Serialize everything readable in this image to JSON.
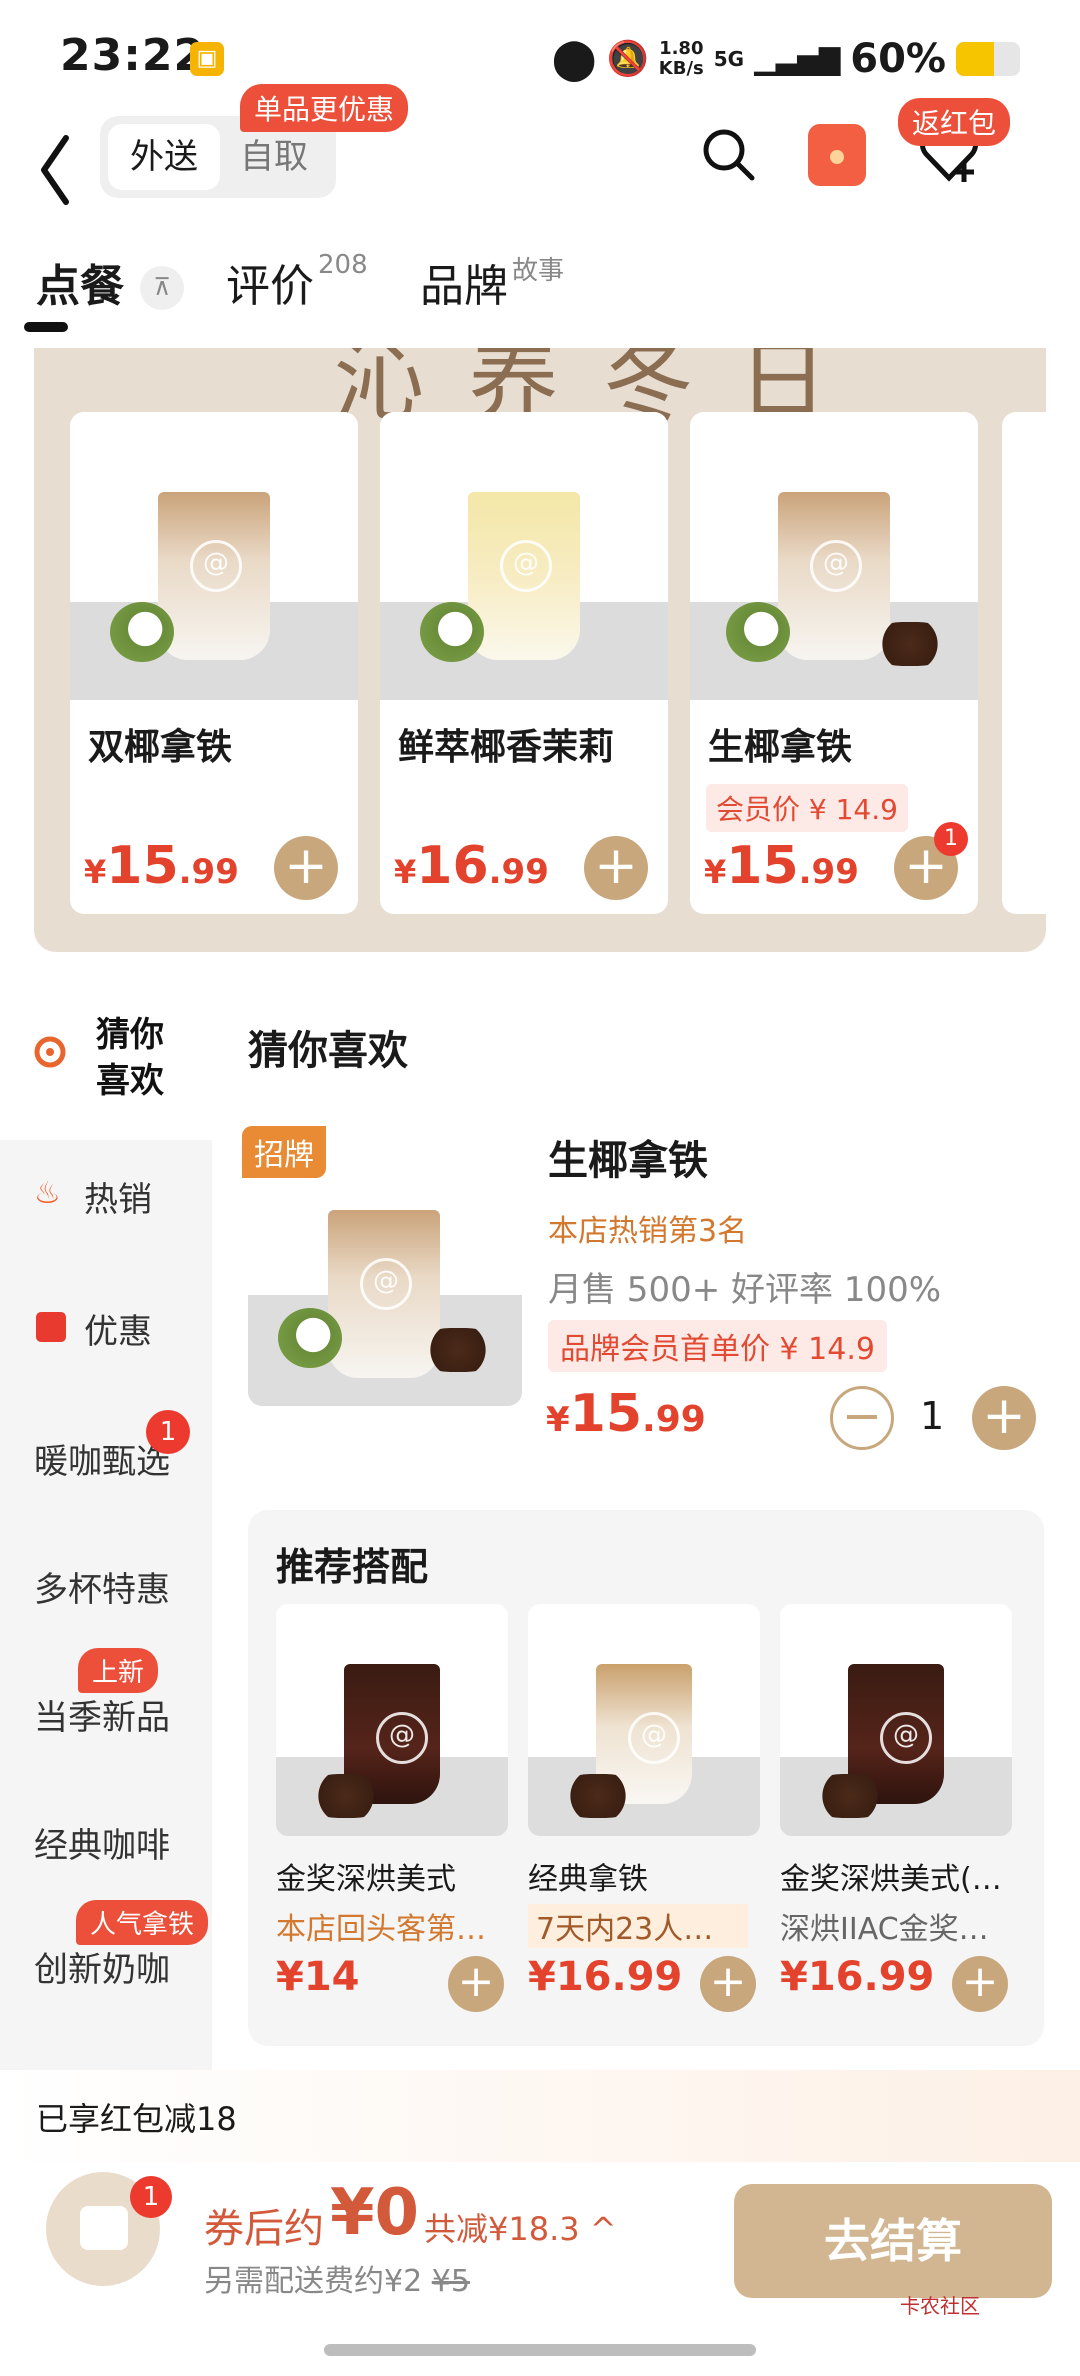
{
  "status_bar": {
    "time": "23:22",
    "net_speed_top": "1.80",
    "net_speed_unit": "KB/s",
    "net_type": "5G",
    "battery": "60%"
  },
  "header": {
    "mode_delivery": "外送",
    "mode_pickup": "自取",
    "promo_tag": "单品更优惠",
    "fan_hongbao": "返红包"
  },
  "tabs": {
    "order": "点餐",
    "review": "评价",
    "review_count": "208",
    "brand": "品牌",
    "brand_sup": "故事",
    "pin_glyph": "⊼"
  },
  "banner": {
    "script_text": "沁 养 冬 日",
    "cards": [
      {
        "name": "双椰拿铁",
        "currency": "¥",
        "price_int": "15",
        "price_dec": ".99"
      },
      {
        "name": "鲜萃椰香茉莉",
        "currency": "¥",
        "price_int": "16",
        "price_dec": ".99"
      },
      {
        "name": "生椰拿铁",
        "member_price": "会员价 ¥ 14.9",
        "currency": "¥",
        "price_int": "15",
        "price_dec": ".99",
        "cart_count": "1"
      }
    ]
  },
  "sidebar": {
    "active": "猜你喜欢",
    "items": [
      {
        "label": "热销"
      },
      {
        "label": "优惠"
      },
      {
        "label": "暖咖甄选",
        "badge": "1"
      },
      {
        "label": "多杯特惠"
      },
      {
        "label": "当季新品",
        "tag": "上新"
      },
      {
        "label": "经典咖啡"
      },
      {
        "label": "创新奶咖",
        "tag": "人气拿铁"
      }
    ]
  },
  "main": {
    "section_title": "猜你喜欢",
    "featured": {
      "tag": "招牌",
      "name": "生椰拿铁",
      "rank": "本店热销第3名",
      "sales": "月售 500+ 好评率 100%",
      "member_price": "品牌会员首单价 ¥ 14.9",
      "currency": "¥",
      "price_int": "15",
      "price_dec": ".99",
      "quantity": "1"
    },
    "recommend": {
      "title": "推荐搭配",
      "items": [
        {
          "name": "金奖深烘美式",
          "sub": "本店回头客第…",
          "price": "¥14"
        },
        {
          "name": "经典拿铁",
          "sub": "7天内23人…",
          "price": "¥16.99"
        },
        {
          "name": "金奖深烘美式(…",
          "sub": "深烘IIAC金奖…",
          "price": "¥16.99"
        }
      ]
    }
  },
  "bottom": {
    "coupon_text": "已享红包减18",
    "cart_count": "1",
    "after_label": "券后约",
    "after_price": "¥0",
    "saved": "共减¥18.3 ^",
    "delivery_text": "另需配送费约¥2",
    "delivery_orig": "¥5",
    "checkout": "去结算",
    "watermark": "卡农社区"
  },
  "colors": {
    "accent": "#e3432d",
    "brand": "#c8a77d",
    "promo": "#ec4f3a",
    "rank": "#d2782f"
  },
  "icons": [
    "back-arrow-icon",
    "search-icon",
    "red-packet-icon",
    "heart-plus-icon",
    "pin-top-icon",
    "guess-eye-icon",
    "fire-icon",
    "coupon-icon",
    "cart-bag-icon",
    "plus-icon",
    "minus-icon"
  ]
}
